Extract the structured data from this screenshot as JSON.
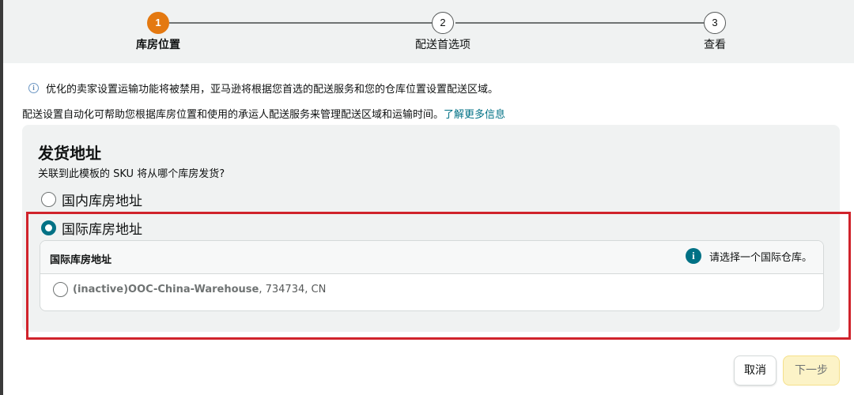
{
  "stepper": {
    "steps": [
      {
        "number": "1",
        "label": "库房位置",
        "active": true
      },
      {
        "number": "2",
        "label": "配送首选项",
        "active": false
      },
      {
        "number": "3",
        "label": "查看",
        "active": false
      }
    ]
  },
  "notice": {
    "icon": "info-icon",
    "text": "优化的卖家设置运输功能将被禁用，亚马逊将根据您首选的配送服务和您的仓库位置设置配送区域。"
  },
  "automation": {
    "text": "配送设置自动化可帮助您根据库房位置和使用的承运人配送服务来管理配送区域和运输时间。",
    "link": "了解更多信息"
  },
  "ship_from": {
    "title": "发货地址",
    "question": "关联到此模板的 SKU 将从哪个库房发货?",
    "options": [
      {
        "label": "国内库房地址",
        "selected": false
      },
      {
        "label": "国际库房地址",
        "selected": true
      }
    ],
    "international": {
      "header": "国际库房地址",
      "hint": "请选择一个国际仓库。",
      "warehouse_name": "(inactive)OOC-China-Warehouse",
      "warehouse_detail": ", 734734, CN"
    }
  },
  "buttons": {
    "cancel": "取消",
    "next": "下一步"
  },
  "colors": {
    "accent_orange": "#e47911",
    "teal": "#007185",
    "highlight_red": "#d0232b",
    "next_button_bg": "#fcf3c7"
  }
}
